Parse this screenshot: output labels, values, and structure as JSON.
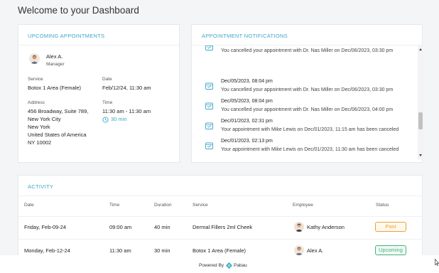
{
  "page": {
    "title": "Welcome to your Dashboard"
  },
  "appointments": {
    "title": "UPCOMING APPOINTMENTS",
    "user": {
      "name": "Alex A.",
      "role": "Manager"
    },
    "service_label": "Service",
    "service": "Botox 1 Area (Female)",
    "date_label": "Date",
    "date": "Feb/12/24, 11:30 am",
    "address_label": "Address",
    "address_lines": [
      "456 Broadway, Suite 789,",
      "New York City",
      "New York",
      "United States of America",
      "NY 10002"
    ],
    "time_label": "Time",
    "time": "11:30 am - 11:30 am",
    "duration": "30 min"
  },
  "notifications": {
    "title": "APPOINTMENT NOTIFICATIONS",
    "items": [
      {
        "date": "",
        "message": "You cancelled your appointment with Dr. Nas Miller on Dec/06/2023, 03:30 pm"
      },
      {
        "date": "Dec/05/2023, 08:04 pm",
        "message": "You cancelled your appointment with Dr. Nas Miller on Dec/06/2023, 03:30 pm"
      },
      {
        "date": "Dec/05/2023, 08:04 pm",
        "message": "You cancelled your appointment with Dr. Nas Miller on Dec/06/2023, 04:00 pm"
      },
      {
        "date": "Dec/01/2023, 02:31 pm",
        "message": "Your appointment with Mike Lewis on Dec/01/2023, 11:15 am has been canceled"
      },
      {
        "date": "Dec/01/2023, 02:13 pm",
        "message": "Your appointment with Mike Lewis on Dec/01/2023, 11:30 am has been canceled"
      }
    ]
  },
  "activity": {
    "title": "ACTIVITY",
    "columns": [
      "Date",
      "Time",
      "Duration",
      "Service",
      "Employee",
      "Status"
    ],
    "rows": [
      {
        "date": "Friday, Feb-09-24",
        "time": "09:00 am",
        "duration": "40 min",
        "service": "Dermal Fillers 2ml Cheek",
        "employee": "Kathy Anderson",
        "status": "Past"
      },
      {
        "date": "Monday, Feb-12-24",
        "time": "11:30 am",
        "duration": "30 min",
        "service": "Botox 1 Area (Female)",
        "employee": "Alex A.",
        "status": "Upcoming"
      }
    ]
  },
  "footer": {
    "powered_by": "Powered By",
    "brand": "Pabau"
  },
  "colors": {
    "accent": "#3aa6c9",
    "past_badge": "#e8a33a",
    "upcoming_badge": "#4cae84"
  }
}
